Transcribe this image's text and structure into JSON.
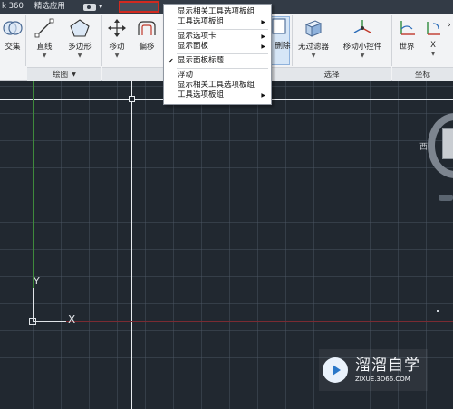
{
  "tabs": {
    "first": "k 360",
    "second": "精选应用"
  },
  "ribbon": {
    "tools": [
      {
        "label": "交集",
        "icon": "intersect-icon"
      },
      {
        "label": "直线",
        "icon": "line-icon"
      },
      {
        "label": "多边形",
        "icon": "polygon-icon"
      },
      {
        "label": "移动",
        "icon": "move-icon"
      },
      {
        "label": "偏移",
        "icon": "offset-icon"
      },
      {
        "label": "删除",
        "icon": "delete-icon"
      },
      {
        "label": "无过滤器",
        "icon": "cube-filter-icon"
      },
      {
        "label": "移动小控件",
        "icon": "gizmo-icon"
      },
      {
        "label": "世界",
        "icon": "world-ucs-icon"
      },
      {
        "label": "X",
        "icon": "x-rotate-icon"
      }
    ],
    "panels": {
      "draw": "绘图",
      "select": "选择",
      "coords": "坐标"
    }
  },
  "context_menu": {
    "items": [
      {
        "label": "显示相关工具选项板组"
      },
      {
        "label": "工具选项板组",
        "submenu": true
      },
      {
        "label": "显示选项卡",
        "submenu": true
      },
      {
        "label": "显示面板",
        "submenu": true
      },
      {
        "label": "显示面板标题",
        "checked": true
      },
      {
        "label": "浮动"
      },
      {
        "label": "显示相关工具选项板组"
      },
      {
        "label": "工具选项板组",
        "submenu": true
      }
    ]
  },
  "canvas": {
    "ucs_y": "Y",
    "ucs_x": "X",
    "viewcube_west": "西"
  },
  "watermark": {
    "brand": "溜溜自学",
    "site": "ZIXUE.3D66.COM"
  },
  "colors": {
    "canvas_bg": "#212830",
    "ribbon_bg": "#f2f3f5",
    "highlight_red": "#d22a20",
    "y_axis_green": "#3f8a3c",
    "x_axis_red": "#7a2b32"
  }
}
